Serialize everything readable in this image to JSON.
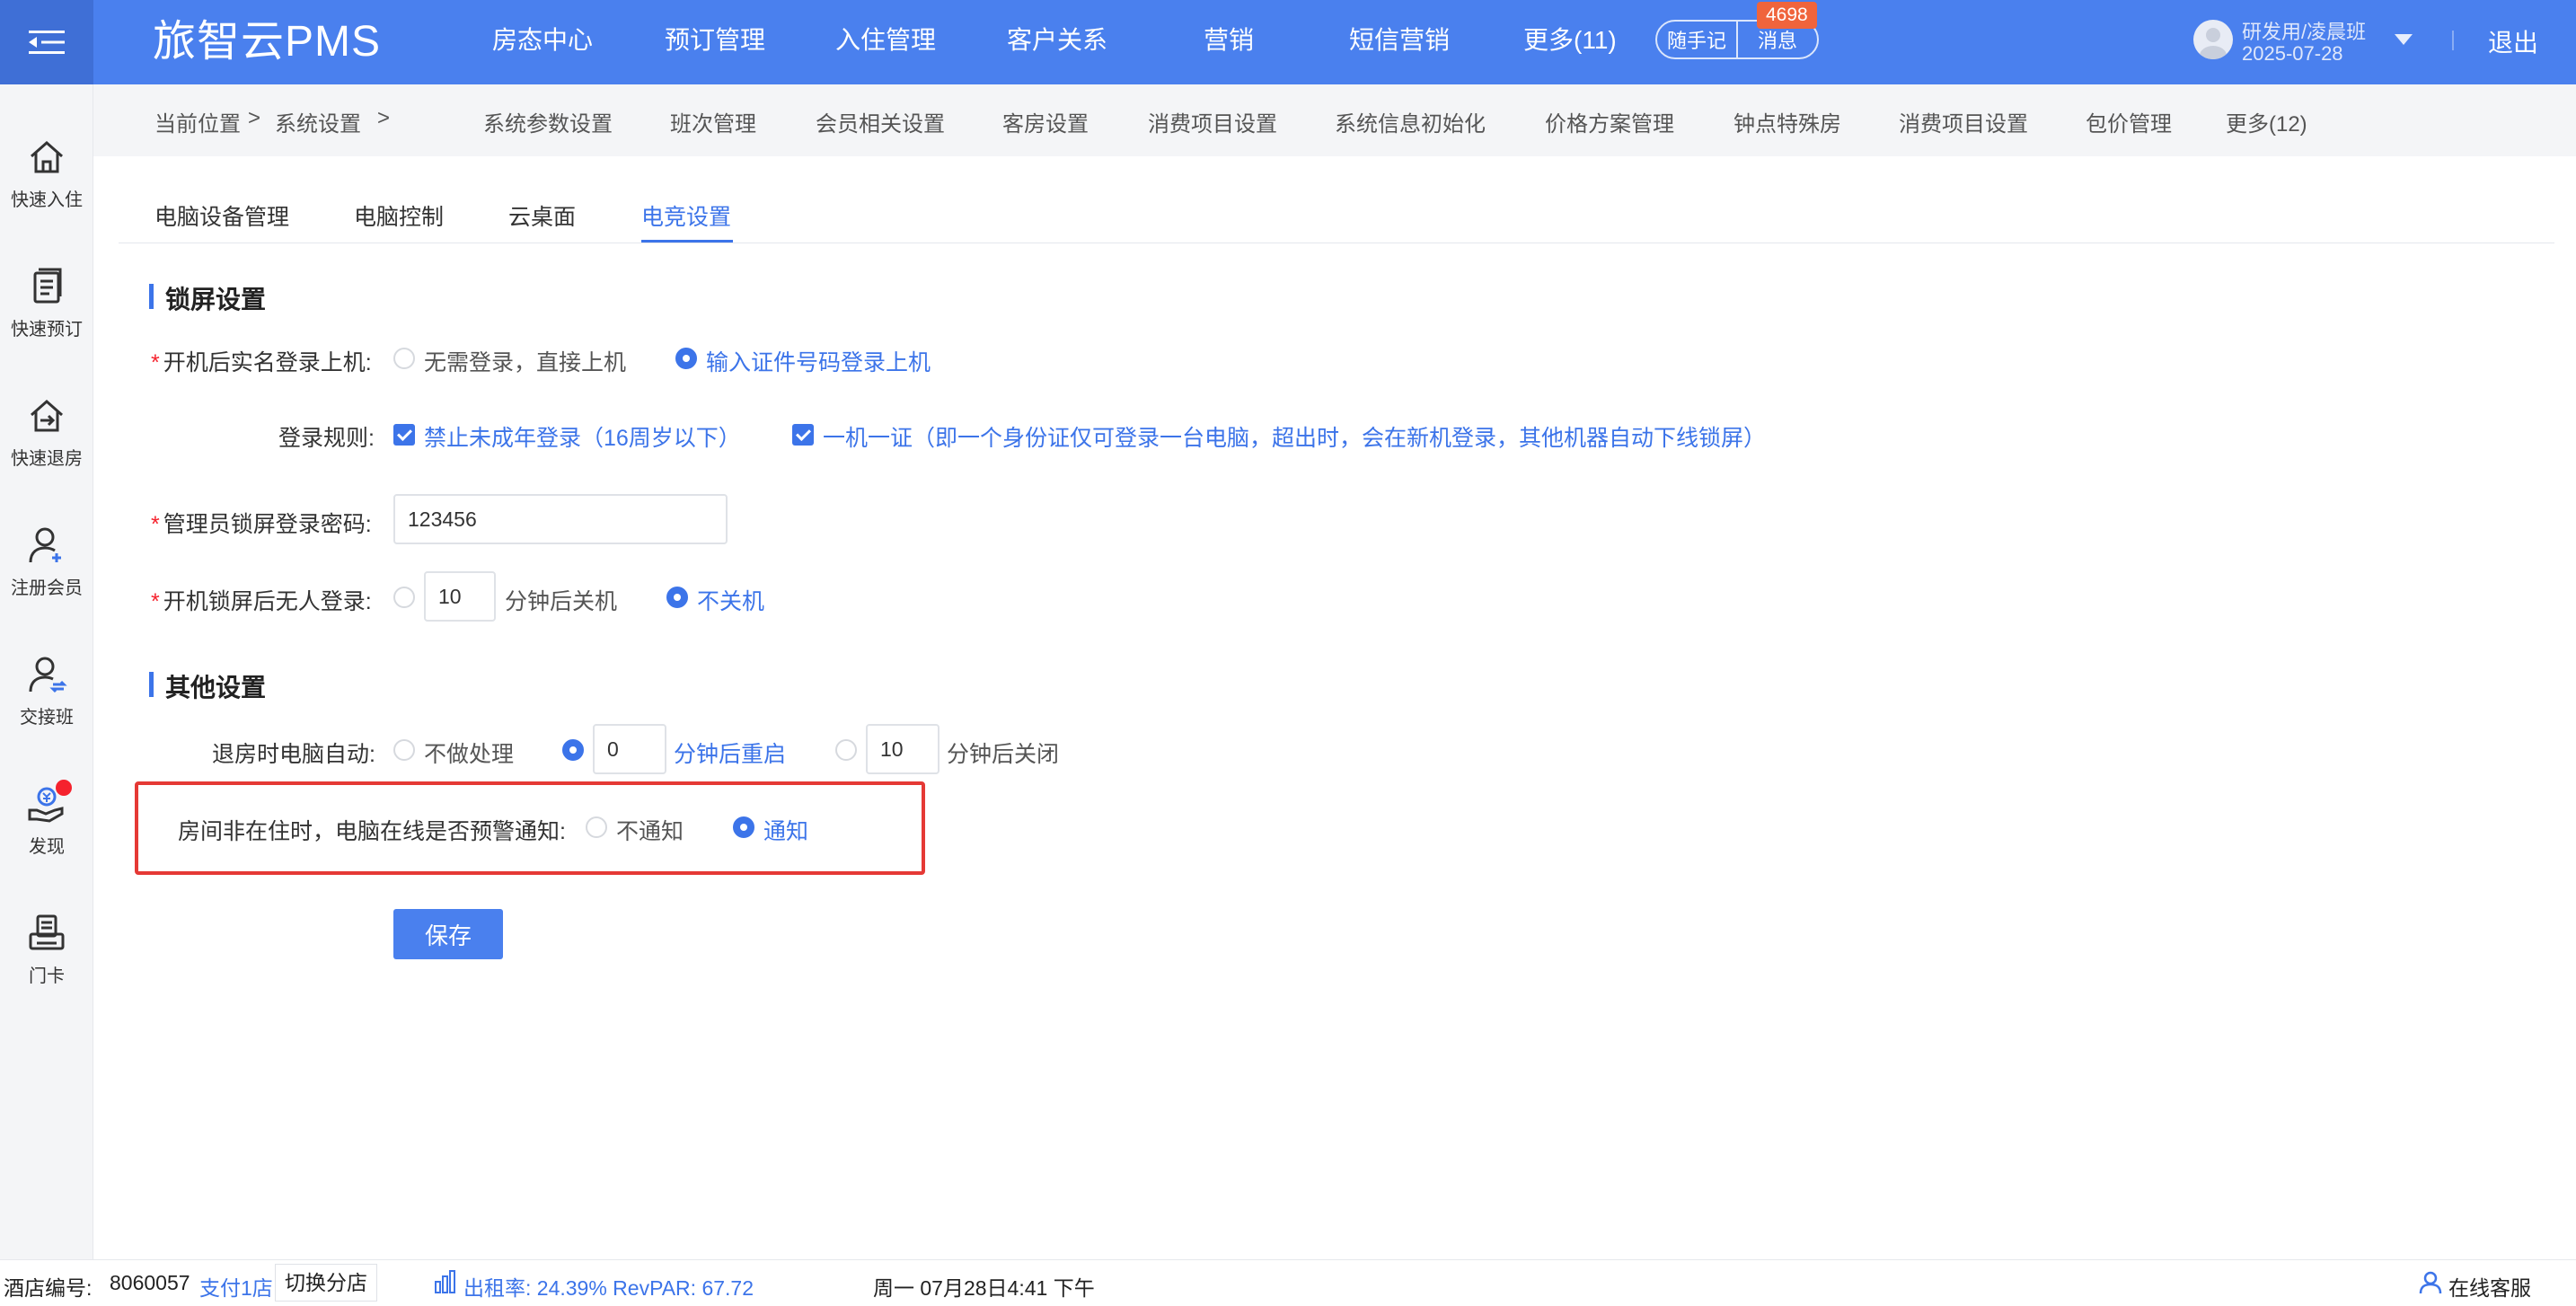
{
  "brand": "旅智云PMS",
  "nav": [
    "房态中心",
    "预订管理",
    "入住管理",
    "客户关系",
    "营销",
    "短信营销",
    "更多(11)"
  ],
  "quick_note": "随手记",
  "messages": {
    "label": "消息",
    "count": "4698"
  },
  "user": {
    "name": "研发用/凌晨班",
    "date": "2025-07-28"
  },
  "logout": "退出",
  "sidebar": [
    "快速入住",
    "快速预订",
    "快速退房",
    "注册会员",
    "交接班",
    "发现",
    "门卡"
  ],
  "breadcrumb": {
    "current": "当前位置",
    "sep1": ">",
    "section": "系统设置",
    "sep2": ">"
  },
  "subnav": [
    "系统参数设置",
    "班次管理",
    "会员相关设置",
    "客房设置",
    "消费项目设置",
    "系统信息初始化",
    "价格方案管理",
    "钟点特殊房",
    "消费项目设置",
    "包价管理",
    "更多(12)"
  ],
  "tabs": [
    "电脑设备管理",
    "电脑控制",
    "云桌面",
    "电竞设置"
  ],
  "active_tab": "电竞设置",
  "lock_section": {
    "title": "锁屏设置",
    "realname": {
      "label": "开机后实名登录上机:",
      "opt_none": "无需登录，直接上机",
      "opt_id": "输入证件号码登录上机",
      "selected": "opt_id"
    },
    "rules": {
      "label": "登录规则:",
      "rule1": "禁止未成年登录（16周岁以下）",
      "rule2": "一机一证（即一个身份证仅可登录一台电脑，超出时，会在新机登录，其他机器自动下线锁屏）"
    },
    "admin_pwd": {
      "label": "管理员锁屏登录密码:",
      "value": "123456"
    },
    "idle": {
      "label": "开机锁屏后无人登录:",
      "minutes": "10",
      "opt_shutdown": "分钟后关机",
      "opt_no": "不关机",
      "selected": "opt_no"
    }
  },
  "other_section": {
    "title": "其他设置",
    "checkout": {
      "label": "退房时电脑自动:",
      "opt_none": "不做处理",
      "restart_minutes": "0",
      "opt_restart": "分钟后重启",
      "close_minutes": "10",
      "opt_close": "分钟后关闭",
      "selected": "opt_restart"
    },
    "alert": {
      "label": "房间非在住时，电脑在线是否预警通知:",
      "opt_no": "不通知",
      "opt_yes": "通知",
      "selected": "opt_yes"
    }
  },
  "save": "保存",
  "footer": {
    "hotel_label": "酒店编号:",
    "hotel_no": "8060057",
    "store": "支付1店",
    "switch": "切换分店",
    "occupancy": "出租率: 24.39% RevPAR: 67.72",
    "datetime": "周一 07月28日4:41 下午",
    "support": "在线客服"
  },
  "colors": {
    "primary": "#4a80ee",
    "active": "#3c74e9",
    "highlight_border": "#e53935",
    "badge": "#f0643c"
  }
}
